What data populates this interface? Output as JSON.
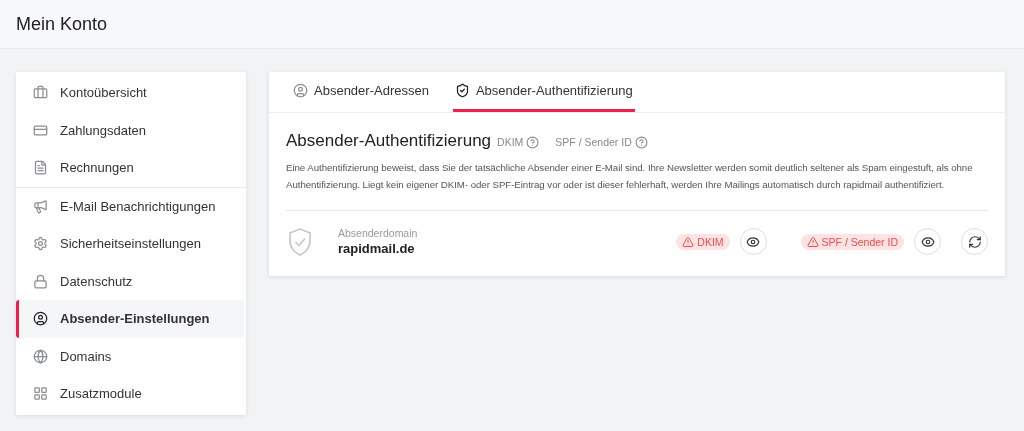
{
  "header": {
    "title": "Mein Konto"
  },
  "sidebar": {
    "groups": [
      [
        {
          "label": "Kontoübersicht",
          "kind": "briefcase",
          "selected": false
        },
        {
          "label": "Zahlungsdaten",
          "kind": "card",
          "selected": false
        },
        {
          "label": "Rechnungen",
          "kind": "invoice",
          "selected": false
        }
      ],
      [
        {
          "label": "E-Mail Benachrichtigungen",
          "kind": "megaphone",
          "selected": false
        },
        {
          "label": "Sicherheitseinstellungen",
          "kind": "gear",
          "selected": false
        },
        {
          "label": "Datenschutz",
          "kind": "lock",
          "selected": false
        },
        {
          "label": "Absender-Einstellungen",
          "kind": "user",
          "selected": true
        },
        {
          "label": "Domains",
          "kind": "globe",
          "selected": false
        },
        {
          "label": "Zusatzmodule",
          "kind": "grid",
          "selected": false
        }
      ]
    ]
  },
  "tabs": [
    {
      "label": "Absender-Adressen",
      "kind": "user",
      "selected": false
    },
    {
      "label": "Absender-Authentifizierung",
      "kind": "shield",
      "selected": true
    }
  ],
  "section": {
    "title": "Absender-Authentifizierung",
    "help_links": [
      "DKIM",
      "SPF / Sender ID"
    ],
    "description": "Eine Authentifizierung beweist, dass Sie der tatsächliche Absender einer E-Mail sind. Ihre Newsletter werden somit deutlich seltener als Spam eingestuft, als ohne Authentifizierung. Liegt kein eigener DKIM- oder SPF-Eintrag vor oder ist dieser fehlerhaft, werden Ihre Mailings automatisch durch rapidmail authentifiziert."
  },
  "domain": {
    "label": "Absenderdomain",
    "value": "rapidmail.de",
    "checks": [
      {
        "label": "DKIM",
        "kind": "warning"
      },
      {
        "label": "SPF / Sender ID",
        "kind": "warning"
      }
    ]
  }
}
